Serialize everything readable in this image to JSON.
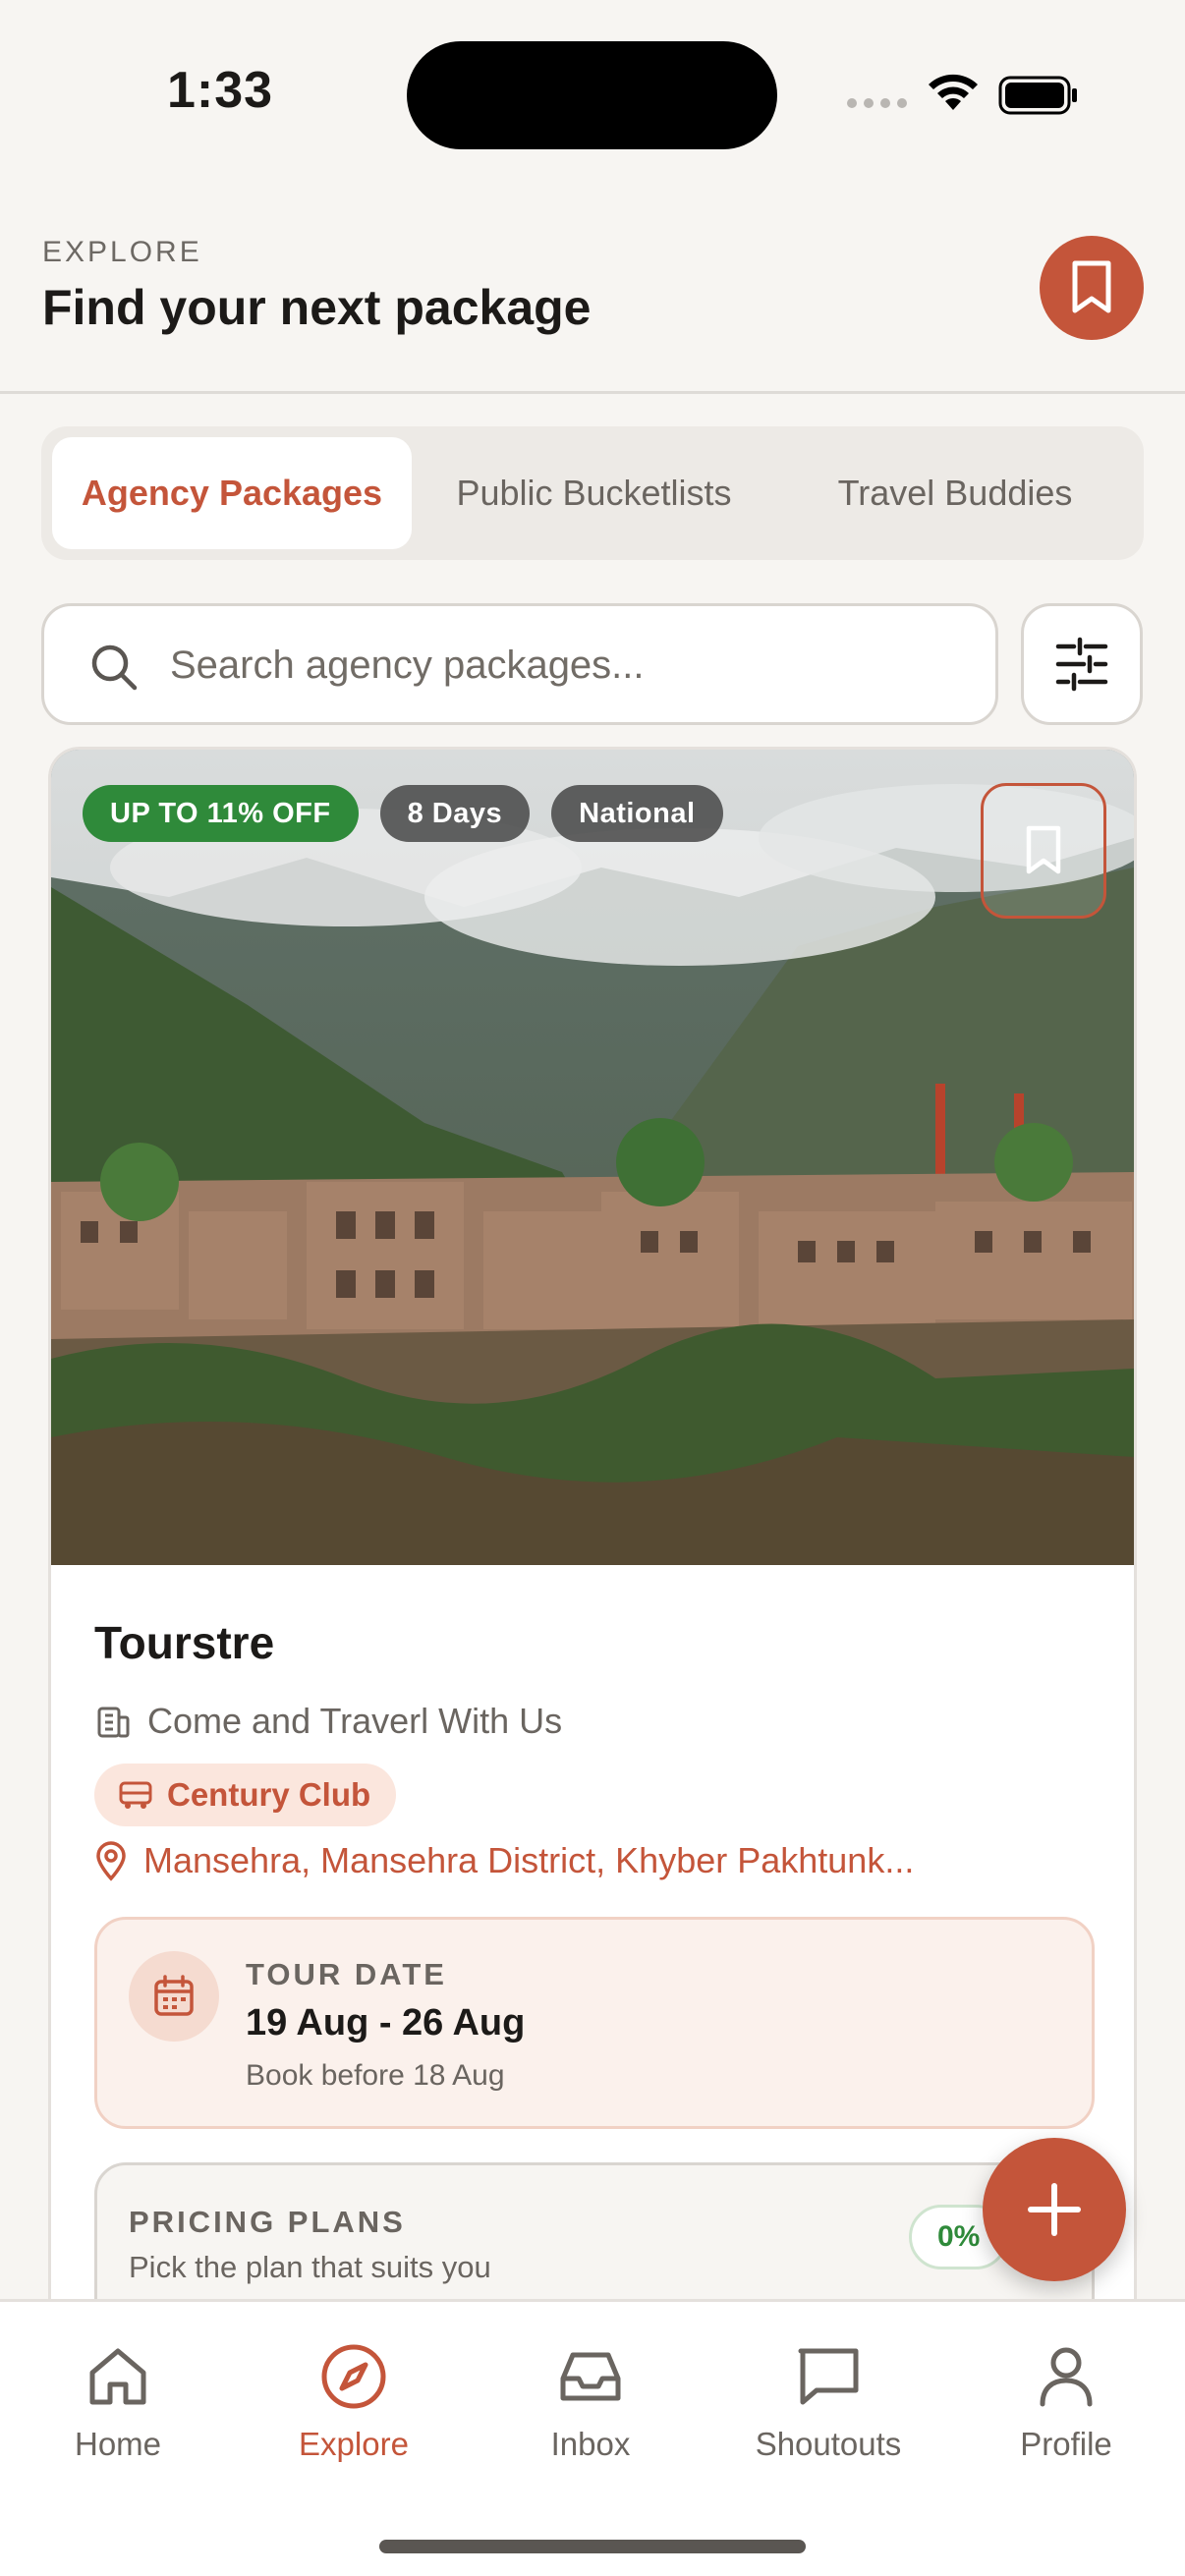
{
  "status_bar": {
    "time": "1:33"
  },
  "header": {
    "eyebrow": "EXPLORE",
    "title": "Find your next package"
  },
  "tabs": [
    {
      "label": "Agency Packages",
      "active": true
    },
    {
      "label": "Public Bucketlists",
      "active": false
    },
    {
      "label": "Travel Buddies",
      "active": false
    }
  ],
  "search": {
    "placeholder": "Search agency packages...",
    "value": ""
  },
  "package": {
    "badges": {
      "discount": "UP TO 11% OFF",
      "duration": "8 Days",
      "scope": "National"
    },
    "agency_name": "Tourstre",
    "tagline": "Come and Traverl With Us",
    "club": "Century Club",
    "location": "Mansehra, Mansehra District, Khyber Pakhtunk...",
    "tour_date": {
      "label": "TOUR DATE",
      "range": "19 Aug - 26 Aug",
      "note": "Book before 18 Aug"
    },
    "pricing": {
      "label": "PRICING PLANS",
      "subtitle": "Pick the plan that suits you",
      "pill": "0%"
    }
  },
  "nav": [
    {
      "label": "Home",
      "icon": "home-icon",
      "active": false
    },
    {
      "label": "Explore",
      "icon": "compass-icon",
      "active": true
    },
    {
      "label": "Inbox",
      "icon": "inbox-icon",
      "active": false
    },
    {
      "label": "Shoutouts",
      "icon": "chat-bubble-icon",
      "active": false
    },
    {
      "label": "Profile",
      "icon": "user-icon",
      "active": false
    }
  ],
  "colors": {
    "accent": "#c4553a",
    "discount": "#2f8a3a",
    "background": "#f7f5f2"
  }
}
